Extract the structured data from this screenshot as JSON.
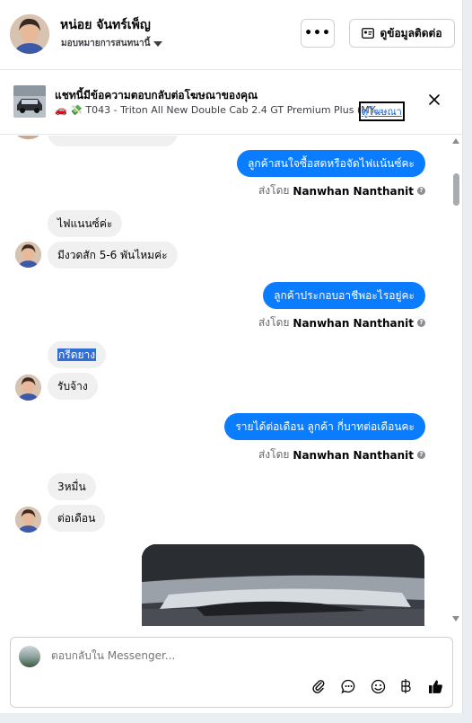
{
  "header": {
    "name": "หน่อย จันทร์เพ็ญ",
    "assign_label": "มอบหมายการสนทนานี้",
    "more_label": "•••",
    "contact_button": "ดูข้อมูลติดต่อ"
  },
  "banner": {
    "title": "แชทนี้มีข้อความตอบกลับต่อโฆษณาของคุณ",
    "subtitle": "🚗 💸 T043 - Triton All New Double Cab 2.4 GT Premium Plus (MY...",
    "link": "ดูโฆษณา"
  },
  "messages": {
    "out1": "ลูกค้าสนใจซื้อสดหรือจัดไฟแน้นซ์คะ",
    "sent1_prefix": "ส่งโดย",
    "sent1_name": "Nanwhan Nanthanit",
    "in1": "ไฟแนนซ์ค่ะ",
    "in2": "มีงวดสัก 5-6 พันไหมค่ะ",
    "out2": "ลูกค้าประกอบอาชีพอะไรอยู่คะ",
    "sent2_prefix": "ส่งโดย",
    "sent2_name": "Nanwhan Nanthanit",
    "in3": "กรีดยาง",
    "in4": "รับจ้าง",
    "out3": "รายได้ต่อเดือน ลูกค้า กี่บาทต่อเดือนคะ",
    "sent3_prefix": "ส่งโดย",
    "sent3_name": "Nanwhan Nanthanit",
    "in5": "3หมื่น",
    "in6": "ต่อเดือน"
  },
  "composer": {
    "placeholder": "ตอบกลับใน Messenger..."
  },
  "colors": {
    "accent": "#0a7cff",
    "incoming_bubble": "#f0f0f0",
    "link": "#1a67d2"
  },
  "icons": [
    "more-icon",
    "contact-card-icon",
    "close-icon",
    "info-icon",
    "attach-icon",
    "saved-reply-icon",
    "emoji-icon",
    "baht-icon",
    "like-icon"
  ]
}
